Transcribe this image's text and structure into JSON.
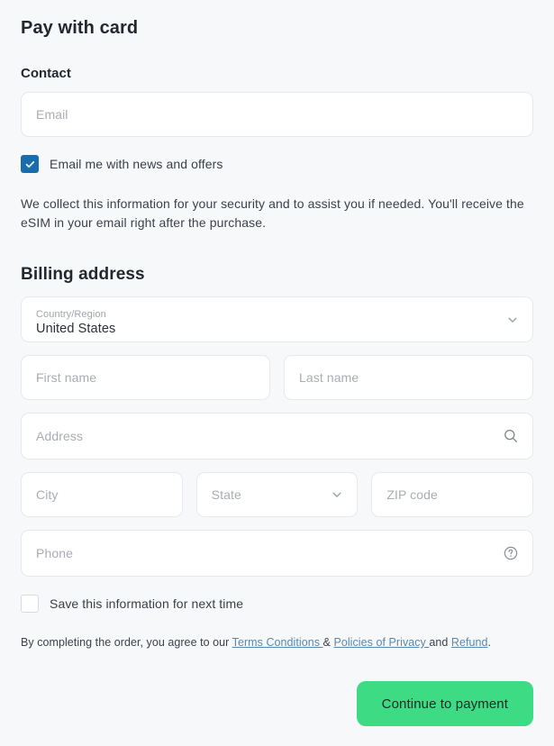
{
  "header": {
    "title": "Pay with card"
  },
  "contact": {
    "label": "Contact",
    "email_placeholder": "Email",
    "newsletter_label": "Email me with news and offers",
    "newsletter_checked": true,
    "info_text": "We collect this information for your security and to assist you if needed. You'll receive the eSIM in your email right after the purchase."
  },
  "billing": {
    "title": "Billing address",
    "country": {
      "label": "Country/Region",
      "value": "United States"
    },
    "first_name_placeholder": "First name",
    "last_name_placeholder": "Last name",
    "address_placeholder": "Address",
    "city_placeholder": "City",
    "state_placeholder": "State",
    "zip_placeholder": "ZIP code",
    "phone_placeholder": "Phone"
  },
  "save_info": {
    "label": "Save this information for next time",
    "checked": false
  },
  "legal": {
    "prefix": "By completing the order, you agree to our ",
    "terms_link": "Terms Conditions ",
    "separator": "& ",
    "privacy_link": "Policies of Privacy ",
    "conjunction": "and ",
    "refund_link": "Refund",
    "suffix": "."
  },
  "footer": {
    "continue_label": "Continue to payment"
  },
  "colors": {
    "page_background": "#f7f8fa",
    "field_background": "#ffffff",
    "field_border": "#e7e9ed",
    "checkbox_checked": "#1a6dad",
    "button_background": "#3ddc84",
    "button_text": "#1d2b24",
    "link": "#5b87ab",
    "heading_text": "#23272e",
    "placeholder_text": "#a9acb3"
  },
  "icons": {
    "country_chevron": "chevron-down-icon",
    "state_chevron": "chevron-down-icon",
    "address_search": "search-icon",
    "phone_help": "help-circle-icon",
    "checkmark": "check-icon"
  }
}
